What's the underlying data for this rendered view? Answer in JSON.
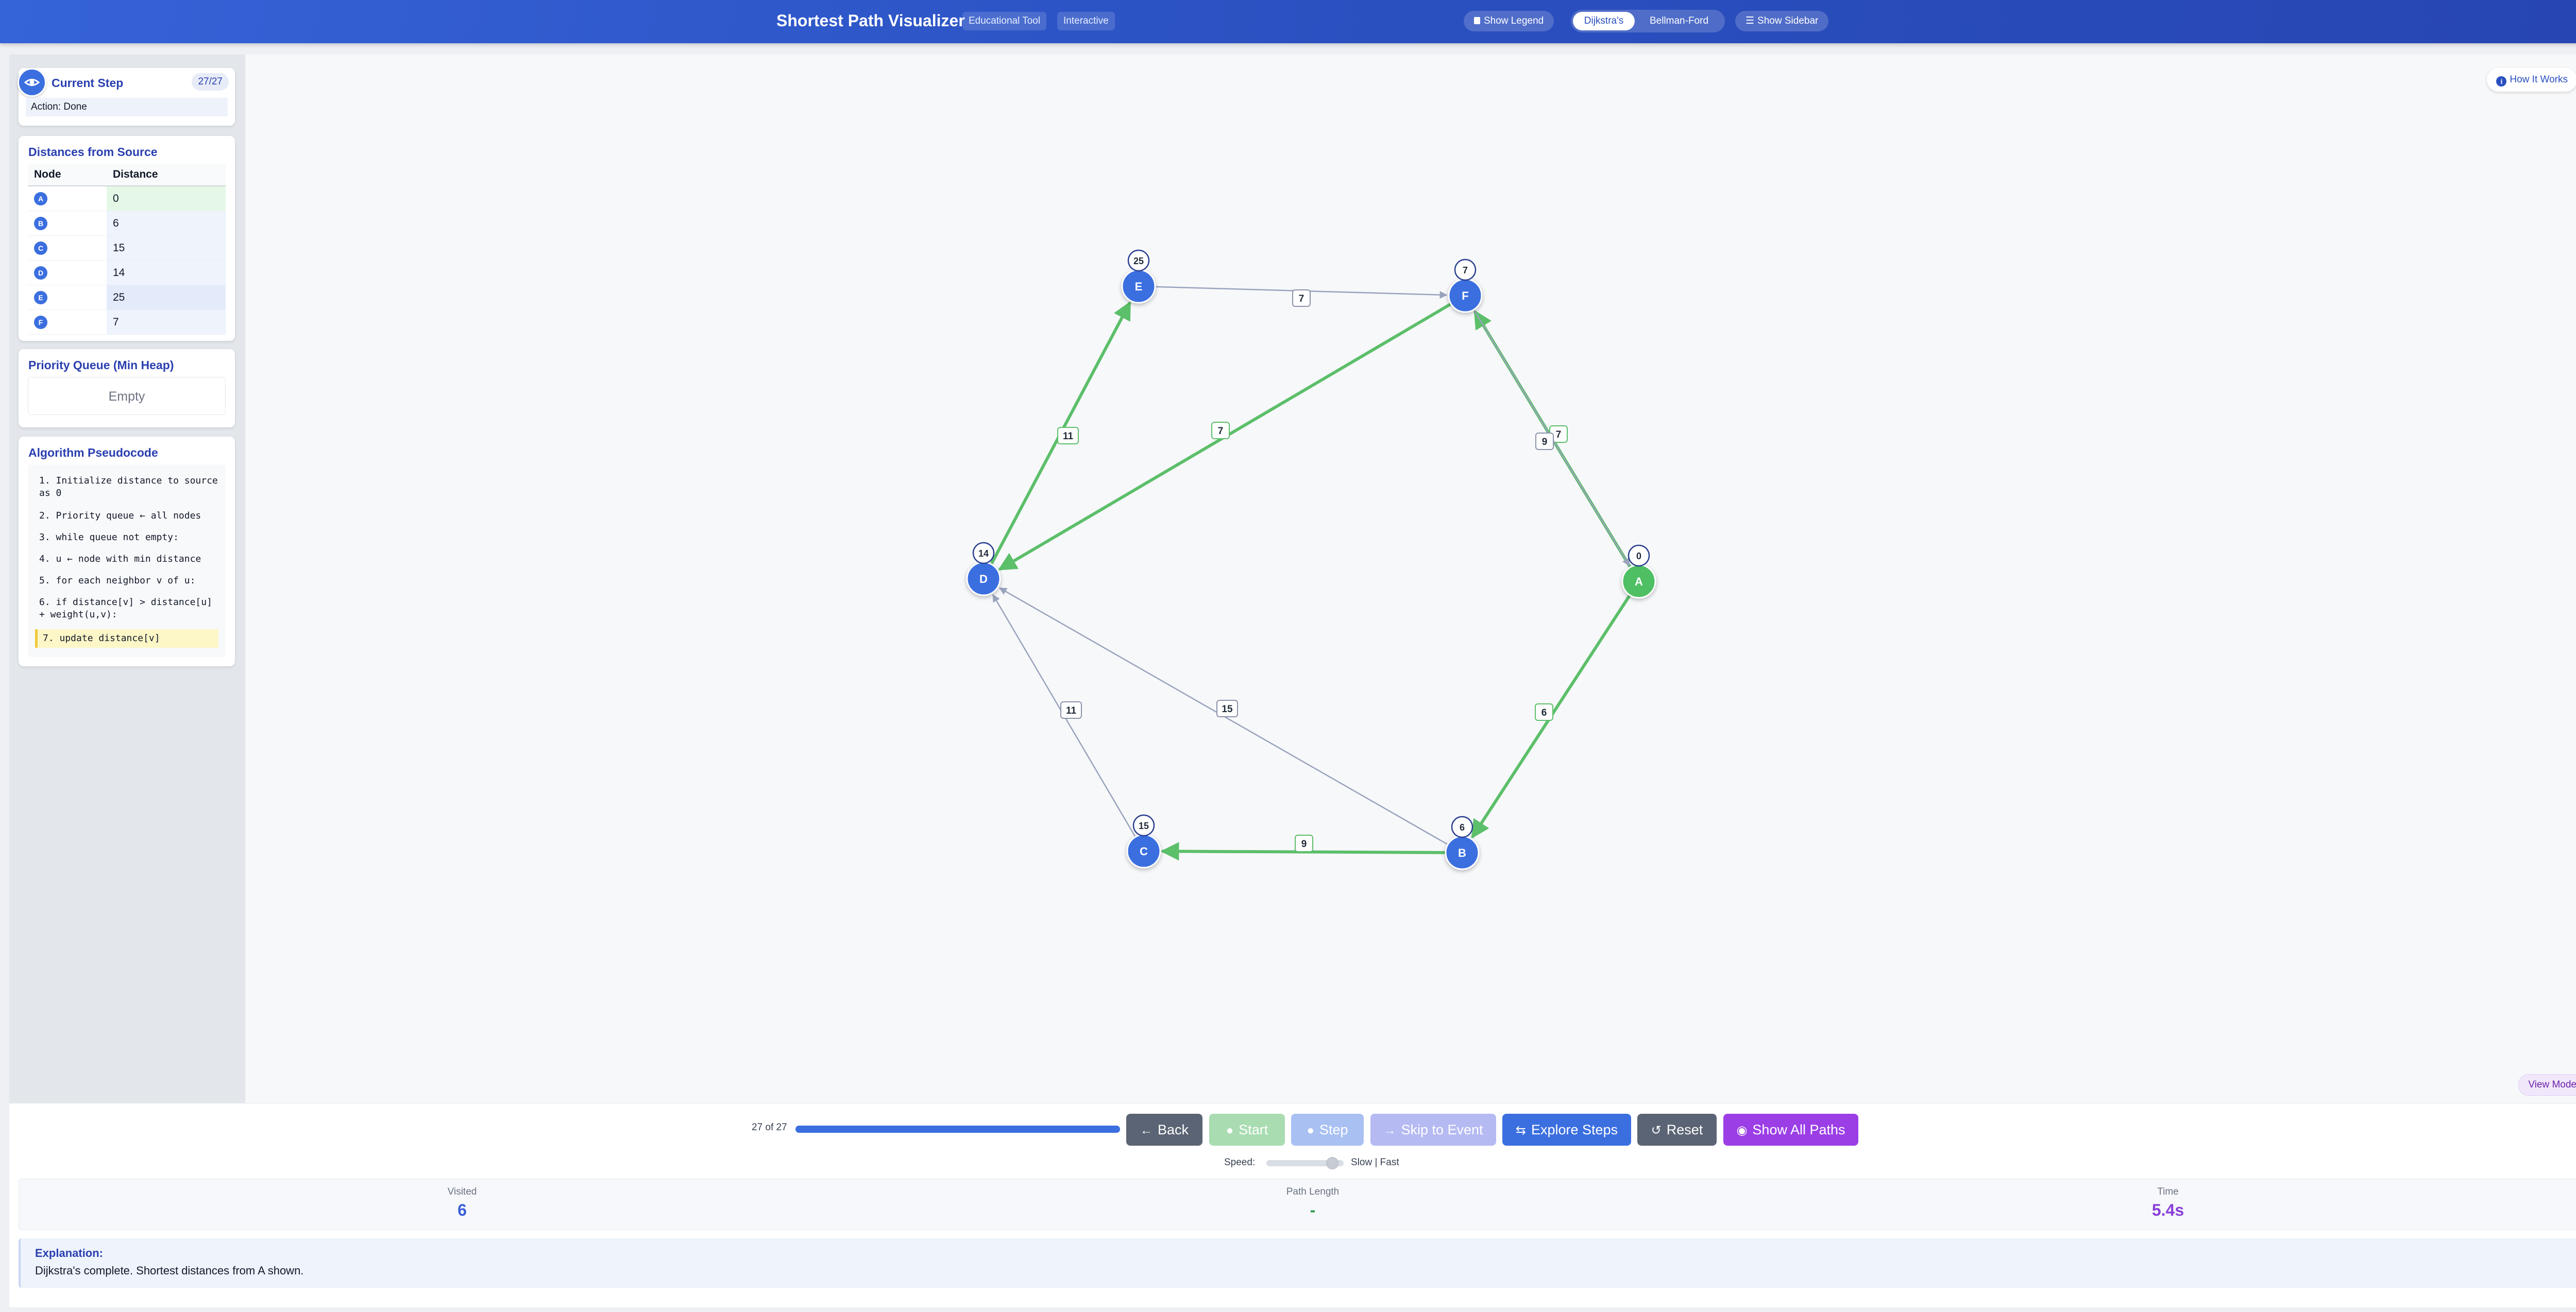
{
  "header": {
    "title": "Shortest Path Visualizer",
    "badges": [
      "Educational Tool",
      "Interactive"
    ],
    "show_legend": "Show Legend",
    "algorithms": [
      "Dijkstra's",
      "Bellman-Ford"
    ],
    "active_algorithm": "Dijkstra's",
    "show_sidebar": "Show Sidebar",
    "color": "#2a4fbf"
  },
  "sidebar": {
    "current_step": {
      "title": "Current Step",
      "counter": "27/27",
      "action": "Action: Done",
      "icon": "eye-icon"
    },
    "distances": {
      "title": "Distances from Source",
      "headers": [
        "Node",
        "Distance"
      ],
      "rows": [
        {
          "node": "A",
          "distance": "0"
        },
        {
          "node": "B",
          "distance": "6"
        },
        {
          "node": "C",
          "distance": "15"
        },
        {
          "node": "D",
          "distance": "14"
        },
        {
          "node": "E",
          "distance": "25"
        },
        {
          "node": "F",
          "distance": "7"
        }
      ]
    },
    "priority_queue": {
      "title": "Priority Queue (Min Heap)",
      "empty_text": "Empty"
    },
    "pseudocode": {
      "title": "Algorithm Pseudocode",
      "lines": [
        "1. Initialize distance to source as 0",
        "2. Priority queue ← all nodes",
        "3. while queue not empty:",
        "4.   u ← node with min distance",
        "5.   for each neighbor v of u:",
        "6.     if distance[v] > distance[u] + weight(u,v):",
        "7.       update distance[v]"
      ],
      "current_line": 7
    }
  },
  "canvas": {
    "how_it_works": "How It Works",
    "view_mode": "View Mode",
    "colors": {
      "node": "#3b6fe0",
      "source": "#4fbf63",
      "tree_edge": "#5cbf6a",
      "edge": "#9aa3bd"
    },
    "nodes": [
      {
        "id": "A",
        "dist": "0",
        "source": true
      },
      {
        "id": "B",
        "dist": "6"
      },
      {
        "id": "C",
        "dist": "15"
      },
      {
        "id": "D",
        "dist": "14"
      },
      {
        "id": "E",
        "dist": "25"
      },
      {
        "id": "F",
        "dist": "7"
      }
    ],
    "edges": [
      {
        "from": "A",
        "to": "B",
        "weight": "6",
        "tree": true
      },
      {
        "from": "A",
        "to": "F",
        "weight": "7",
        "tree": true
      },
      {
        "from": "F",
        "to": "A",
        "weight": "9",
        "tree": false
      },
      {
        "from": "B",
        "to": "C",
        "weight": "9",
        "tree": true
      },
      {
        "from": "B",
        "to": "D",
        "weight": "15",
        "tree": false
      },
      {
        "from": "C",
        "to": "D",
        "weight": "11",
        "tree": false
      },
      {
        "from": "F",
        "to": "D",
        "weight": "7",
        "tree": true
      },
      {
        "from": "D",
        "to": "E",
        "weight": "11",
        "tree": true
      },
      {
        "from": "E",
        "to": "F",
        "weight": "7",
        "tree": false
      }
    ]
  },
  "controls": {
    "progress_label": "27 of 27",
    "progress": 1.0,
    "buttons": {
      "back": "Back",
      "start": "Start",
      "step": "Step",
      "skip": "Skip to Event",
      "explore": "Explore Steps",
      "reset": "Reset",
      "show_all": "Show All Paths"
    },
    "speed_label": "Speed:",
    "speed_hint": "Slow | Fast",
    "speed": 0.85
  },
  "stats": {
    "visited_label": "Visited",
    "visited": "6",
    "path_length_label": "Path Length",
    "path_length": "-",
    "time_label": "Time",
    "time": "5.4s"
  },
  "explanation": {
    "title": "Explanation:",
    "text": "Dijkstra's complete. Shortest distances from A shown."
  }
}
